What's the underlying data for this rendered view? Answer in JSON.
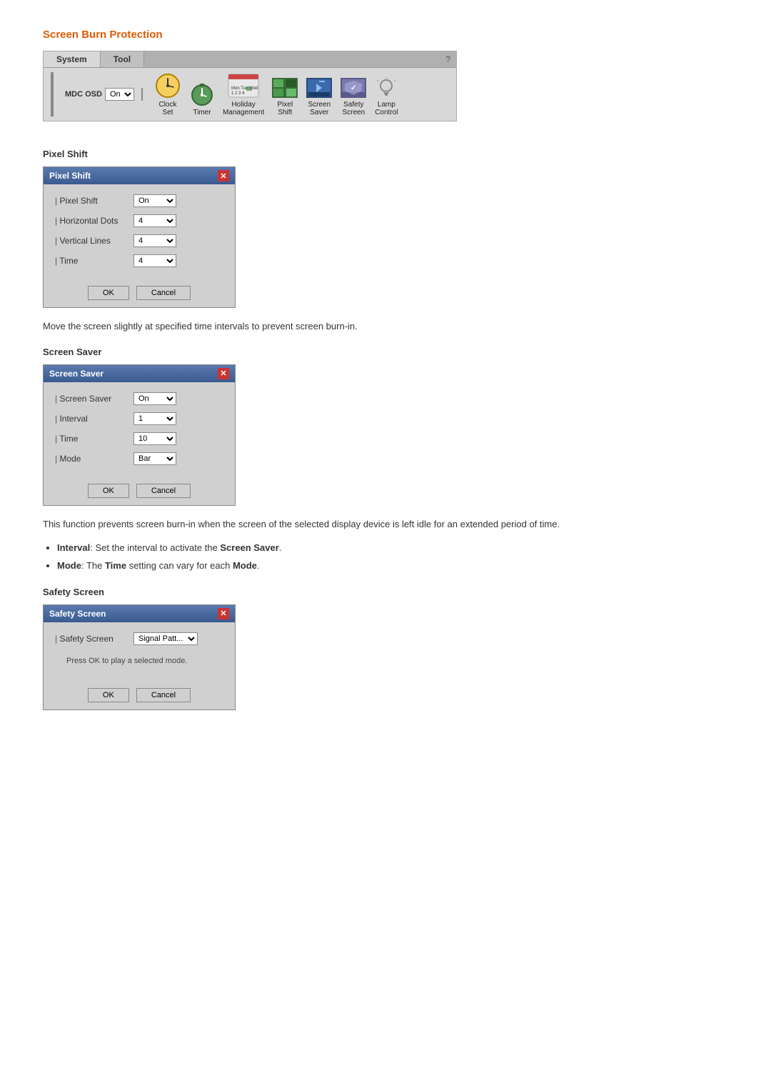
{
  "page": {
    "main_title": "Screen Burn Protection",
    "toolbar": {
      "tabs": [
        {
          "label": "System",
          "active": true
        },
        {
          "label": "Tool",
          "active": false
        }
      ],
      "help_icon": "?",
      "mdc_osd_label": "MDC OSD",
      "mdc_osd_value": "On",
      "icons": [
        {
          "name": "clock-set",
          "label": "Clock\nSet",
          "type": "clock"
        },
        {
          "name": "timer",
          "label": "Timer",
          "type": "timer"
        },
        {
          "name": "holiday-management",
          "label": "Holiday\nManagement",
          "type": "holiday"
        },
        {
          "name": "pixel-shift",
          "label": "Pixel\nShift",
          "type": "pixel"
        },
        {
          "name": "screen-saver",
          "label": "Screen\nSaver",
          "type": "screensaver"
        },
        {
          "name": "safety-screen",
          "label": "Safety\nScreen",
          "type": "safety"
        },
        {
          "name": "lamp-control",
          "label": "Lamp\nControl",
          "type": "lamp"
        }
      ]
    },
    "pixel_shift_section": {
      "title": "Pixel Shift",
      "dialog_title": "Pixel Shift",
      "rows": [
        {
          "label": "Pixel Shift",
          "value": "On",
          "type": "select"
        },
        {
          "label": "Horizontal Dots",
          "value": "4",
          "type": "select"
        },
        {
          "label": "Vertical Lines",
          "value": "4",
          "type": "select"
        },
        {
          "label": "Time",
          "value": "4",
          "type": "select"
        }
      ],
      "ok_btn": "OK",
      "cancel_btn": "Cancel",
      "description": "Move the screen slightly at specified time intervals to prevent screen burn-in."
    },
    "screen_saver_section": {
      "title": "Screen Saver",
      "dialog_title": "Screen Saver",
      "rows": [
        {
          "label": "Screen Saver",
          "value": "On",
          "type": "select"
        },
        {
          "label": "Interval",
          "value": "1",
          "type": "select"
        },
        {
          "label": "Time",
          "value": "10",
          "type": "select"
        },
        {
          "label": "Mode",
          "value": "Bar",
          "type": "select"
        }
      ],
      "ok_btn": "OK",
      "cancel_btn": "Cancel",
      "description": "This function prevents screen burn-in when the screen of the selected display device is left idle for an extended period of time.",
      "bullets": [
        {
          "label": "Interval",
          "colon": ": Set the interval to activate the ",
          "bold_word": "Screen Saver",
          "rest": "."
        },
        {
          "label": "Mode",
          "colon": ": The ",
          "bold_word": "Time",
          "rest": " setting can vary for each ",
          "bold_word2": "Mode",
          "rest2": "."
        }
      ]
    },
    "safety_screen_section": {
      "title": "Safety Screen",
      "dialog_title": "Safety Screen",
      "rows": [
        {
          "label": "Safety Screen",
          "value": "Signal Patt...",
          "type": "select"
        }
      ],
      "note": "Press OK to play a selected mode.",
      "ok_btn": "OK",
      "cancel_btn": "Cancel"
    }
  }
}
